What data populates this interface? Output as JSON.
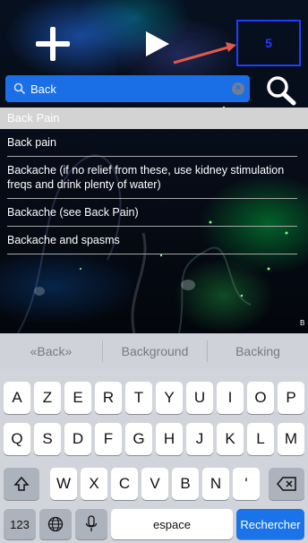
{
  "toolbar": {
    "add_icon": "plus-icon",
    "play_icon": "play-icon",
    "counter_value": "5",
    "arrow_color": "#e05a4a",
    "counter_color": "#1f3cff"
  },
  "search": {
    "value": "Back",
    "clear_label": "×",
    "accent": "#1a6fe6"
  },
  "results": {
    "header": "Back Pain",
    "items": [
      "Back pain",
      "Backache (if no relief from these, use kidney stimulation freqs and drink plenty of water)",
      "Backache (see Back Pain)",
      "Backache and spasms"
    ]
  },
  "corner_mark": "B",
  "keyboard": {
    "suggestions": [
      "«Back»",
      "Background",
      "Backing"
    ],
    "row1": [
      "A",
      "Z",
      "E",
      "R",
      "T",
      "Y",
      "U",
      "I",
      "O",
      "P"
    ],
    "row2": [
      "Q",
      "S",
      "D",
      "F",
      "G",
      "H",
      "J",
      "K",
      "L",
      "M"
    ],
    "row3": [
      "W",
      "X",
      "C",
      "V",
      "B",
      "N",
      "'"
    ],
    "numbers_label": "123",
    "space_label": "espace",
    "search_label": "Rechercher"
  }
}
